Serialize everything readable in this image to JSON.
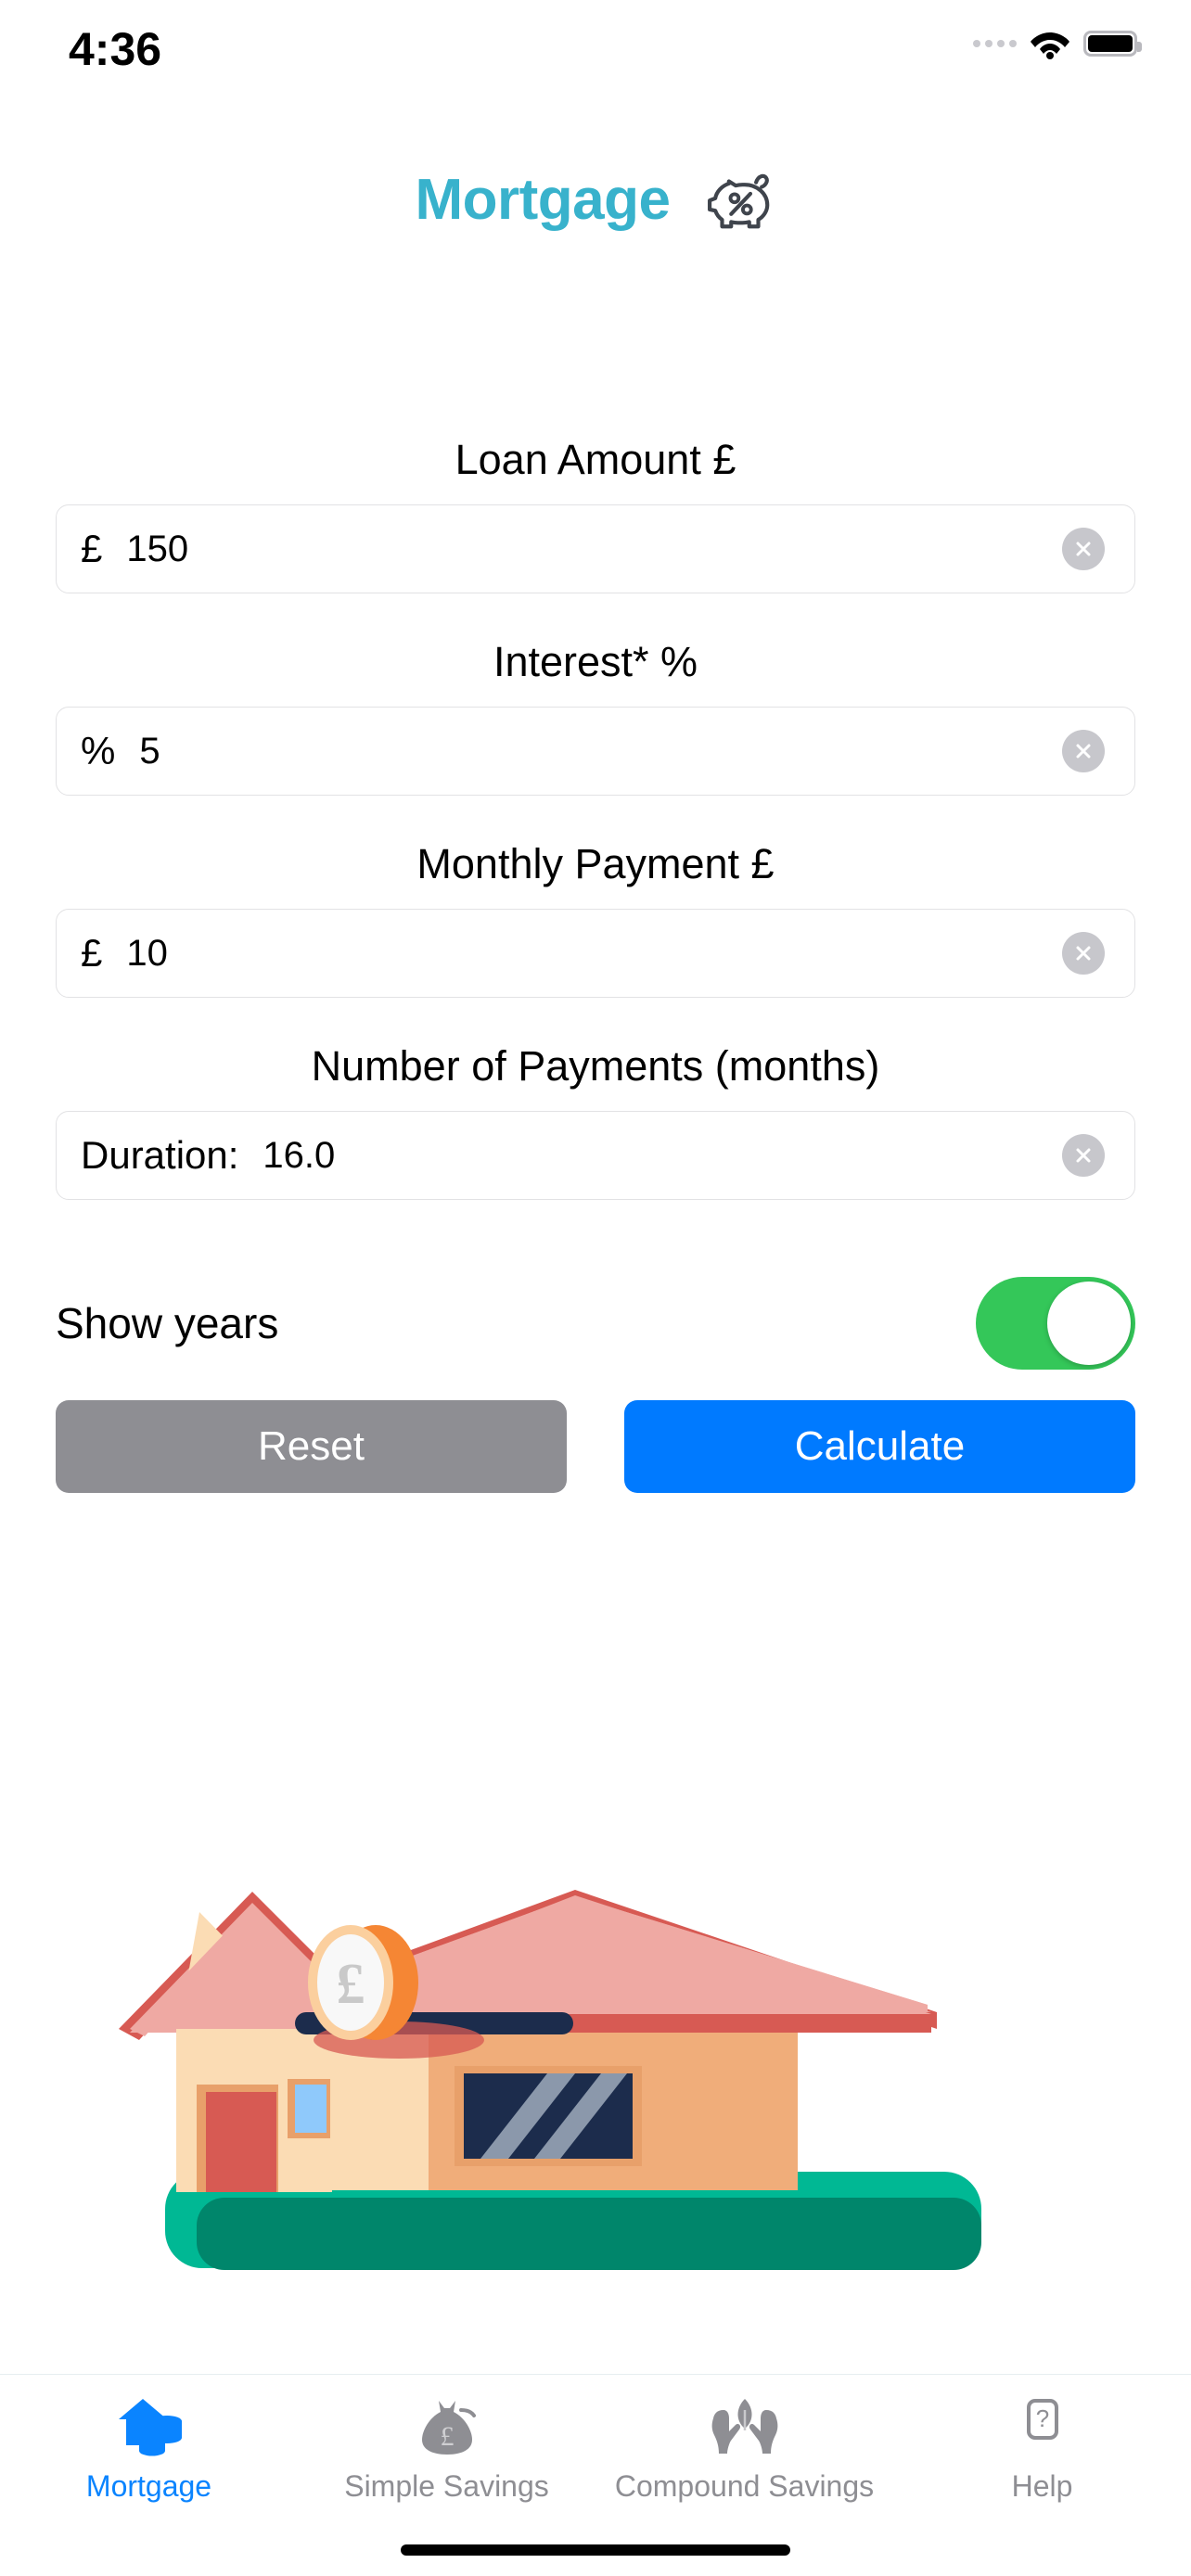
{
  "status_bar": {
    "time": "4:36",
    "signal_icon": "signal-dots-icon",
    "wifi_icon": "wifi-icon",
    "battery_icon": "battery-full-icon"
  },
  "header": {
    "title": "Mortgage",
    "icon": "piggy-bank-percent-icon",
    "title_color": "#38b2cc"
  },
  "form": {
    "fields": [
      {
        "label": "Loan Amount £",
        "prefix": "£",
        "value": "150",
        "clear_icon": "clear-circle-x-icon"
      },
      {
        "label": "Interest* %",
        "prefix": "%",
        "value": "5",
        "clear_icon": "clear-circle-x-icon"
      },
      {
        "label": "Monthly Payment £",
        "prefix": "£",
        "value": "10",
        "clear_icon": "clear-circle-x-icon"
      },
      {
        "label": "Number of Payments (months)",
        "prefix": "Duration:",
        "value": "16.0",
        "clear_icon": "clear-circle-x-icon"
      }
    ],
    "toggle": {
      "label": "Show years",
      "state": "on",
      "on_color": "#34c759"
    },
    "buttons": {
      "reset": "Reset",
      "calculate": "Calculate",
      "reset_color": "#8e8e93",
      "calculate_color": "#007aff"
    }
  },
  "illustration": {
    "name": "house-piggy-bank-with-pound-coin",
    "coin_symbol": "£",
    "roof_color": "#efa9a3",
    "wall_color": "#fbdcb4",
    "door_color": "#d75a53",
    "grass_color": "#00b894"
  },
  "tab_bar": {
    "items": [
      {
        "label": "Mortgage",
        "icon": "house-coins-icon",
        "active": true
      },
      {
        "label": "Simple Savings",
        "icon": "money-bag-pound-icon",
        "active": false
      },
      {
        "label": "Compound Savings",
        "icon": "hands-leaf-icon",
        "active": false
      },
      {
        "label": "Help",
        "icon": "question-mark-box-icon",
        "active": false
      }
    ],
    "active_color": "#0a84ff",
    "inactive_color": "#8e8e93"
  }
}
